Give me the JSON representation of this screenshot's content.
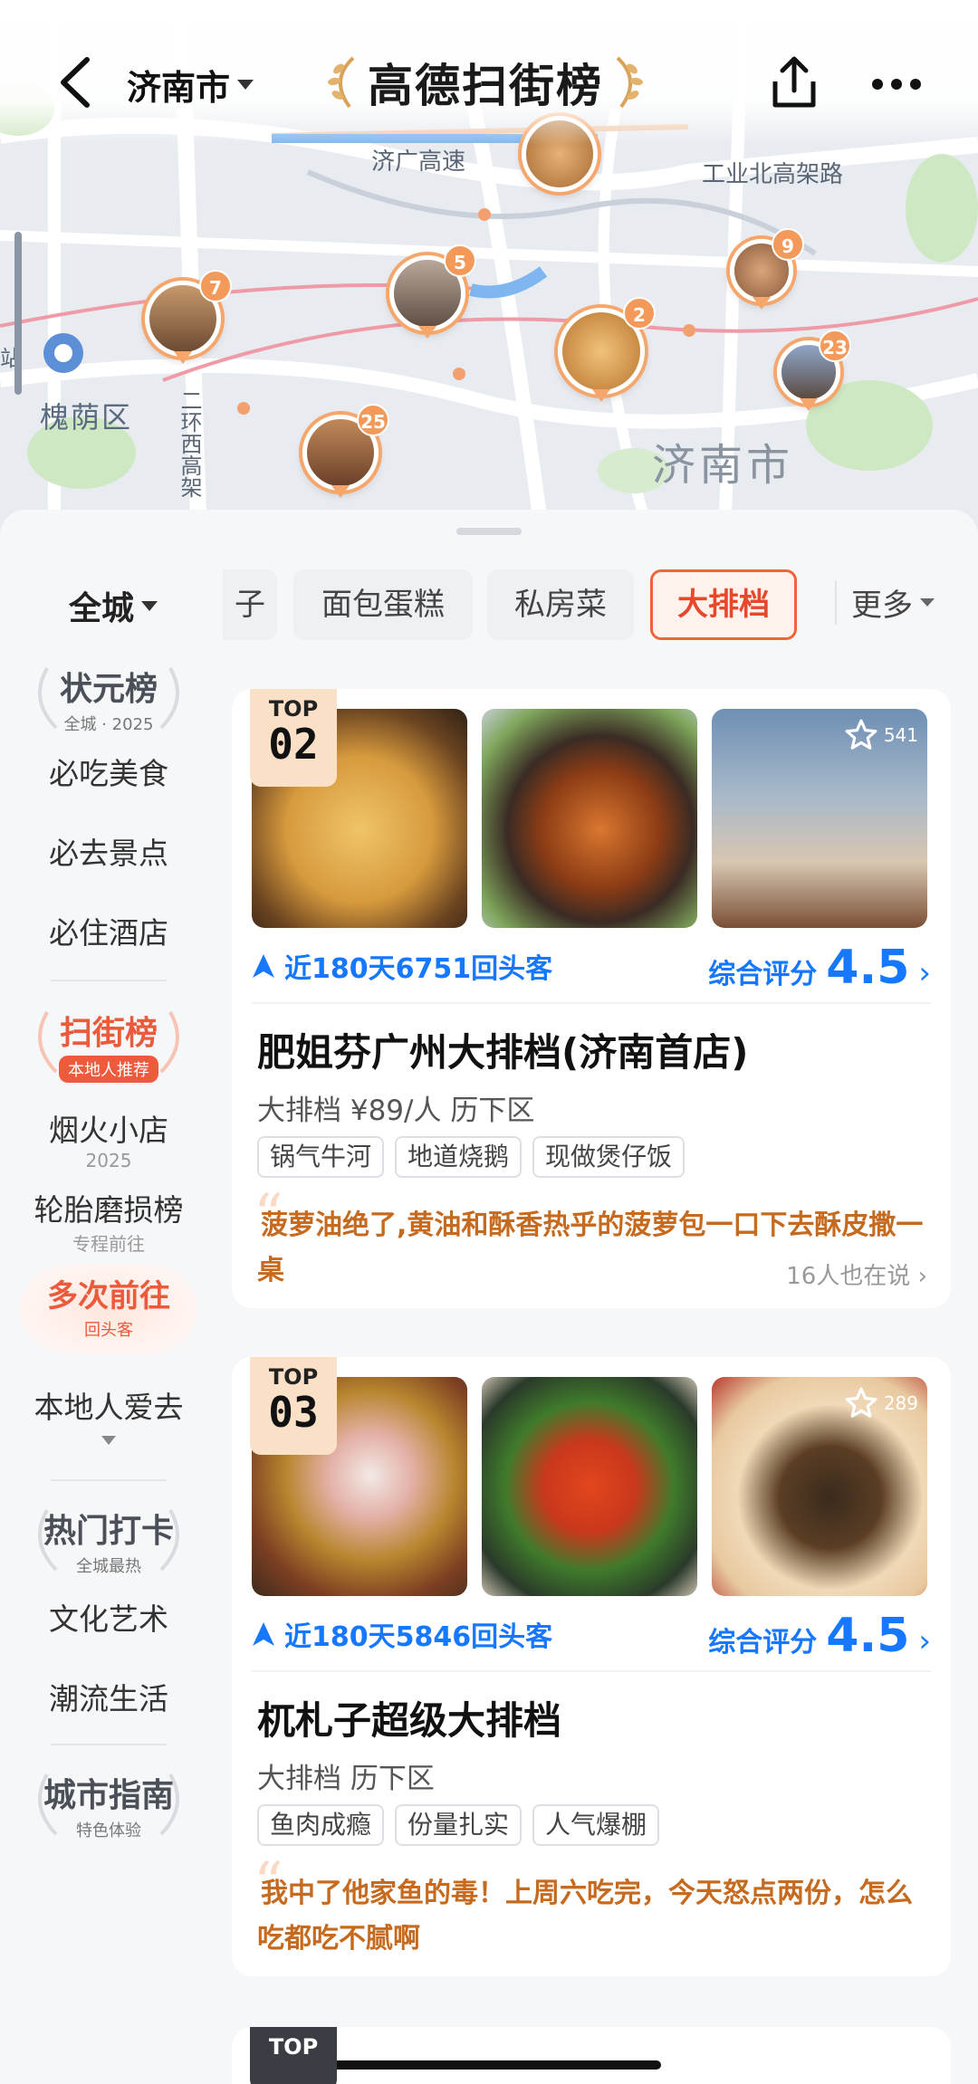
{
  "header": {
    "city": "济南市",
    "logo_text": "高德扫街榜"
  },
  "map": {
    "labels": {
      "road1": "济广高速",
      "road2": "工业北高架路",
      "district": "槐荫区",
      "city": "济南市",
      "ring": "二环西高架",
      "station": "站"
    },
    "pins": [
      "7",
      "5",
      "2",
      "9",
      "23",
      "25"
    ]
  },
  "categories": {
    "all": "全城",
    "chips": [
      "子",
      "面包蛋糕",
      "私房菜",
      "大排档"
    ],
    "active": "大排档",
    "more": "更多"
  },
  "sidenav": {
    "zhuangyuan": {
      "title": "状元榜",
      "sub": "全城 · 2025"
    },
    "items1": [
      "必吃美食",
      "必去景点",
      "必住酒店"
    ],
    "saojie": {
      "title": "扫街榜",
      "sub": "本地人推荐"
    },
    "yanhuo": {
      "title": "烟火小店",
      "sub": "2025"
    },
    "luntai": {
      "title": "轮胎磨损榜",
      "sub": "专程前往"
    },
    "duoci": {
      "title": "多次前往",
      "sub": "回头客"
    },
    "local": "本地人爱去",
    "hot": {
      "title": "热门打卡",
      "sub": "全城最热"
    },
    "items2": [
      "文化艺术",
      "潮流生活"
    ],
    "guide": {
      "title": "城市指南",
      "sub": "特色体验"
    }
  },
  "cards": [
    {
      "rank_label": "TOP",
      "rank": "02",
      "favorites": "541",
      "returning": "近180天6751回头客",
      "score_label": "综合评分",
      "score": "4.5",
      "name": "肥姐芬广州大排档(济南首店)",
      "meta": "大排档 ¥89/人 历下区",
      "tags": [
        "锅气牛河",
        "地道烧鹅",
        "现做煲仔饭"
      ],
      "review": "菠萝油绝了,黄油和酥香热乎的菠萝包一口下去酥皮撒一桌",
      "talk": "16人也在说"
    },
    {
      "rank_label": "TOP",
      "rank": "03",
      "favorites": "289",
      "returning": "近180天5846回头客",
      "score_label": "综合评分",
      "score": "4.5",
      "name": "杌札子超级大排档",
      "meta": "大排档 历下区",
      "tags": [
        "鱼肉成瘾",
        "份量扎实",
        "人气爆棚"
      ],
      "review": "我中了他家鱼的毒！上周六吃完，今天怒点两份，怎么吃都吃不腻啊"
    }
  ],
  "next_card": {
    "rank_label": "TOP"
  },
  "colors": {
    "accent_blue": "#1677ff",
    "accent_orange": "#f0643c",
    "review_orange": "#c56a1e"
  }
}
